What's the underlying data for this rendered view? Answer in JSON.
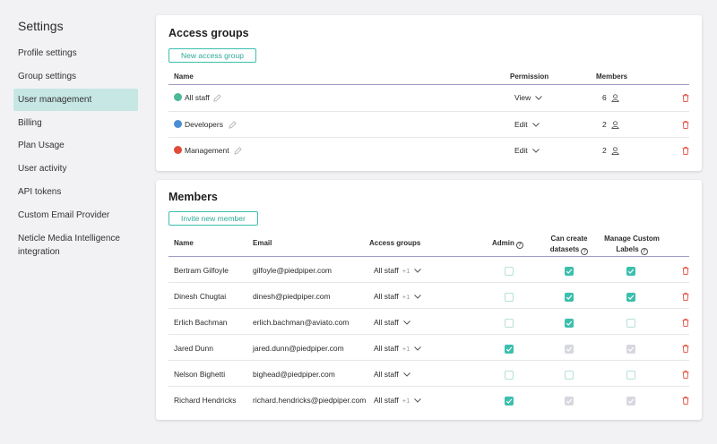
{
  "sidebar": {
    "title": "Settings",
    "items": [
      {
        "label": "Profile settings"
      },
      {
        "label": "Group settings"
      },
      {
        "label": "User management"
      },
      {
        "label": "Billing"
      },
      {
        "label": "Plan Usage"
      },
      {
        "label": "User activity"
      },
      {
        "label": "API tokens"
      },
      {
        "label": "Custom Email Provider"
      },
      {
        "label": "Neticle Media Intelligence integration"
      }
    ]
  },
  "access_groups": {
    "title": "Access groups",
    "new_button": "New access group",
    "columns": {
      "name": "Name",
      "permission": "Permission",
      "members": "Members"
    },
    "rows": [
      {
        "name": "All staff",
        "color": "#4db89a",
        "permission": "View",
        "members": "6"
      },
      {
        "name": "Developers",
        "color": "#4a8fd6",
        "permission": "Edit",
        "members": "2"
      },
      {
        "name": "Management",
        "color": "#e04b3a",
        "permission": "Edit",
        "members": "2"
      }
    ]
  },
  "members": {
    "title": "Members",
    "invite_button": "Invite new member",
    "columns": {
      "name": "Name",
      "email": "Email",
      "access_groups": "Access groups",
      "admin": "Admin",
      "can_create_1": "Can create",
      "can_create_2": "datasets",
      "manage_1": "Manage Custom",
      "manage_2": "Labels"
    },
    "rows": [
      {
        "name": "Bertram Gilfoyle",
        "email": "gilfoyle@piedpiper.com",
        "group": "All staff",
        "extra": "+1",
        "admin": "off",
        "datasets": "on",
        "labels": "on"
      },
      {
        "name": "Dinesh Chugtai",
        "email": "dinesh@piedpiper.com",
        "group": "All staff",
        "extra": "+1",
        "admin": "off",
        "datasets": "on",
        "labels": "on"
      },
      {
        "name": "Erlich Bachman",
        "email": "erlich.bachman@aviato.com",
        "group": "All staff",
        "extra": "",
        "admin": "off",
        "datasets": "on",
        "labels": "off"
      },
      {
        "name": "Jared Dunn",
        "email": "jared.dunn@piedpiper.com",
        "group": "All staff",
        "extra": "+1",
        "admin": "on",
        "datasets": "disabled",
        "labels": "disabled"
      },
      {
        "name": "Nelson Bighetti",
        "email": "bighead@piedpiper.com",
        "group": "All staff",
        "extra": "",
        "admin": "off",
        "datasets": "off",
        "labels": "off"
      },
      {
        "name": "Richard Hendricks",
        "email": "richard.hendricks@piedpiper.com",
        "group": "All staff",
        "extra": "+1",
        "admin": "on",
        "datasets": "disabled",
        "labels": "disabled"
      }
    ]
  },
  "colors": {
    "accent": "#3cbfae",
    "delete": "#e04b3a",
    "active_nav": "#c7e7e4"
  }
}
